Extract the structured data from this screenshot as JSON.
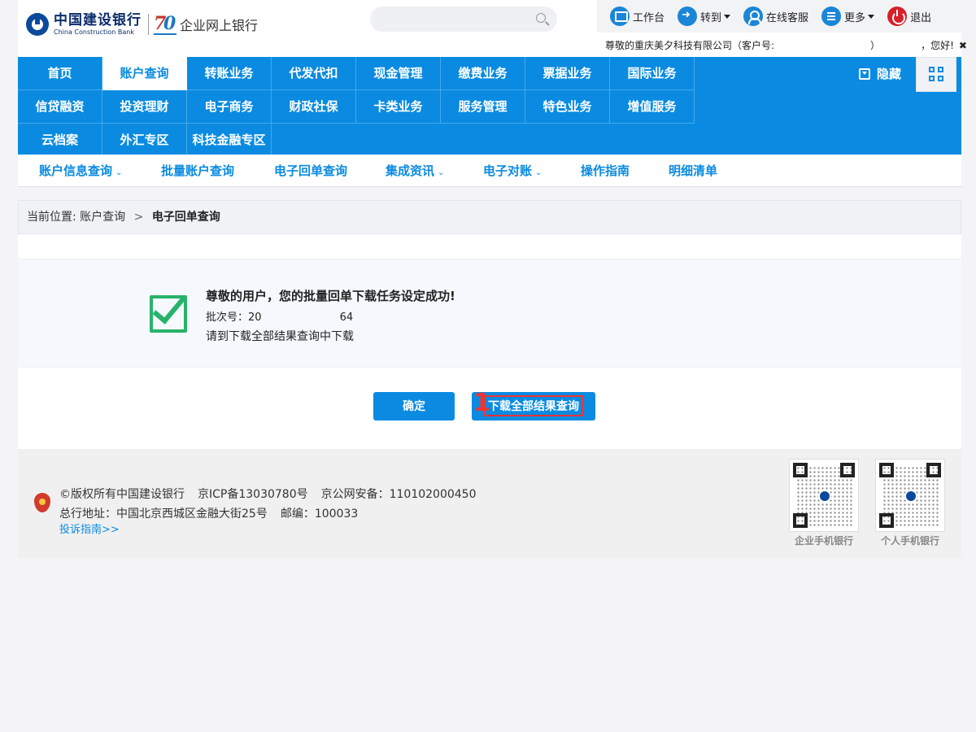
{
  "header": {
    "logo_cn": "中国建设银行",
    "logo_en": "China Construction Bank",
    "logo_anniv_7": "7",
    "logo_anniv_0": "0",
    "logo_sub": "企业网上银行",
    "toolbar": [
      {
        "label": "工作台",
        "icon": "monitor-icon"
      },
      {
        "label": "转到",
        "icon": "arrow-right-icon",
        "dropdown": true
      },
      {
        "label": "在线客服",
        "icon": "person-icon"
      },
      {
        "label": "更多",
        "icon": "list-icon",
        "dropdown": true
      },
      {
        "label": "退出",
        "icon": "power-icon"
      }
    ],
    "greeting_prefix": "尊敬的重庆美夕科技有限公司（客户号:",
    "greeting_close": "）",
    "greeting_suffix": "，您好!",
    "close_glyph": "✖"
  },
  "nav": {
    "rows": [
      [
        "首页",
        "账户查询",
        "转账业务",
        "代发代扣",
        "现金管理",
        "缴费业务",
        "票据业务",
        "国际业务"
      ],
      [
        "信贷融资",
        "投资理财",
        "电子商务",
        "财政社保",
        "卡类业务",
        "服务管理",
        "特色业务",
        "增值服务"
      ],
      [
        "云档案",
        "外汇专区",
        "科技金融专区"
      ]
    ],
    "active": "账户查询",
    "hide_label": "隐藏"
  },
  "subnav": [
    {
      "label": "账户信息查询",
      "dropdown": true
    },
    {
      "label": "批量账户查询",
      "dropdown": false
    },
    {
      "label": "电子回单查询",
      "dropdown": false
    },
    {
      "label": "集成资讯",
      "dropdown": true
    },
    {
      "label": "电子对账",
      "dropdown": true
    },
    {
      "label": "操作指南",
      "dropdown": false
    },
    {
      "label": "明细清单",
      "dropdown": false
    }
  ],
  "breadcrumb": {
    "prefix": "当前位置:",
    "parent": "账户查询",
    "separator": ">",
    "current": "电子回单查询"
  },
  "message": {
    "title": "尊敬的用户，您的批量回单下载任务设定成功!",
    "batch_label": "批次号：",
    "batch_start": "20",
    "batch_end": "64",
    "hint": "请到下载全部结果查询中下载"
  },
  "buttons": {
    "ok": "确定",
    "download": "下载全部结果查询",
    "marker": "1"
  },
  "footer": {
    "copyright": "©版权所有中国建设银行",
    "icp": "京ICP备13030780号",
    "police": "京公网安备：110102000450",
    "address": "总行地址：中国北京西城区金融大街25号",
    "postcode": "邮编：100033",
    "complaint": "投诉指南>>",
    "qr_enterprise": "企业手机银行",
    "qr_personal": "个人手机银行"
  },
  "colors": {
    "primary": "#0a8be1",
    "success": "#27b36a",
    "highlight": "#e33333"
  }
}
